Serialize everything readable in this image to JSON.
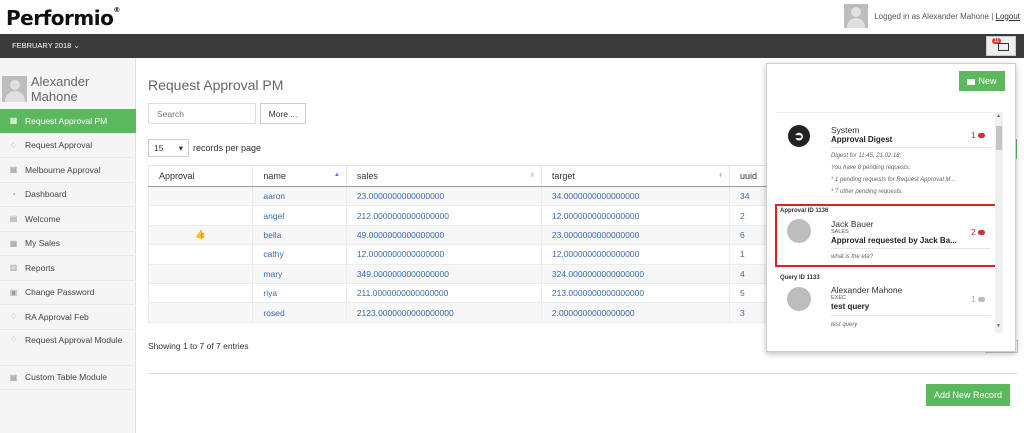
{
  "brand": {
    "logo": "Performio",
    "mark": "®"
  },
  "header": {
    "logged_in": "Logged in as Alexander Mahone |",
    "logout": "Logout",
    "period": "FEBRUARY 2018",
    "mail_badge": "11"
  },
  "sidebar": {
    "user": "Alexander Mahone",
    "items": [
      {
        "label": "Request Approval PM",
        "icon": "grid-icon"
      },
      {
        "label": "Request Approval",
        "icon": "thumbs-up-icon"
      },
      {
        "label": "Melbourne Approval",
        "icon": "grid-icon"
      },
      {
        "label": "Dashboard",
        "icon": "dashboard-icon"
      },
      {
        "label": "Welcome",
        "icon": "file-icon"
      },
      {
        "label": "My Sales",
        "icon": "grid-icon"
      },
      {
        "label": "Reports",
        "icon": "bar-chart-icon"
      },
      {
        "label": "Change Password",
        "icon": "lock-icon"
      },
      {
        "label": "RA Approval Feb",
        "icon": "thumbs-up-icon"
      },
      {
        "label": "Request Approval Module",
        "icon": "thumbs-up-icon"
      },
      {
        "label": "Custom Table Module",
        "icon": "grid-icon"
      }
    ]
  },
  "main": {
    "title": "Request Approval PM",
    "search_placeholder": "Search",
    "more_label": "More ...",
    "page_length": "15",
    "records_label": "records per page",
    "columns": [
      "Approval",
      "name",
      "sales",
      "target",
      "uuid"
    ],
    "rows": [
      {
        "approval": "",
        "name": "aaron",
        "sales": "23.0000000000000000",
        "target": "34.0000000000000000",
        "uuid": "34"
      },
      {
        "approval": "",
        "name": "angel",
        "sales": "212.0000000000000000",
        "target": "12.0000000000000000",
        "uuid": "2"
      },
      {
        "approval": "👍",
        "name": "bella",
        "sales": "49.0000000000000000",
        "target": "23.0000000000000000",
        "uuid": "6"
      },
      {
        "approval": "",
        "name": "cathy",
        "sales": "12.0000000000000000",
        "target": "12.0000000000000000",
        "uuid": "1"
      },
      {
        "approval": "",
        "name": "mary",
        "sales": "349.0000000000000000",
        "target": "324.0000000000000000",
        "uuid": "4"
      },
      {
        "approval": "",
        "name": "riya",
        "sales": "211.0000000000000000",
        "target": "213.0000000000000000",
        "uuid": "5"
      },
      {
        "approval": "",
        "name": "rosed",
        "sales": "2123.0000000000000000",
        "target": "2.0000000000000000",
        "uuid": "3"
      }
    ],
    "info": "Showing 1 to 7 of 7 entries",
    "add_label": "Add New Record"
  },
  "notifications": {
    "new_label": "New",
    "items": [
      {
        "label": "",
        "name": "System",
        "role": "",
        "subject": "Approval Digest",
        "count": "1",
        "lines": [
          "Digest for 11:45, 21.02.18:",
          "You have 8 pending requests.",
          "* 1 pending requests for Request Approval M...",
          "* 7 other pending requests."
        ]
      },
      {
        "label": "Approval ID 1136",
        "name": "Jack Bauer",
        "role": "SALES",
        "subject": "Approval requested by Jack Ba...",
        "count": "2",
        "lines": [
          "what is the eta?"
        ]
      },
      {
        "label": "Query ID 1133",
        "name": "Alexander Mahone",
        "role": "EXEC",
        "subject": "test query",
        "count": "1",
        "lines": [
          "test query"
        ]
      }
    ]
  },
  "colors": {
    "accent": "#5cb85c",
    "navbar": "#3a3a3a",
    "link": "#3a6aa8",
    "highlight": "#e02020"
  }
}
